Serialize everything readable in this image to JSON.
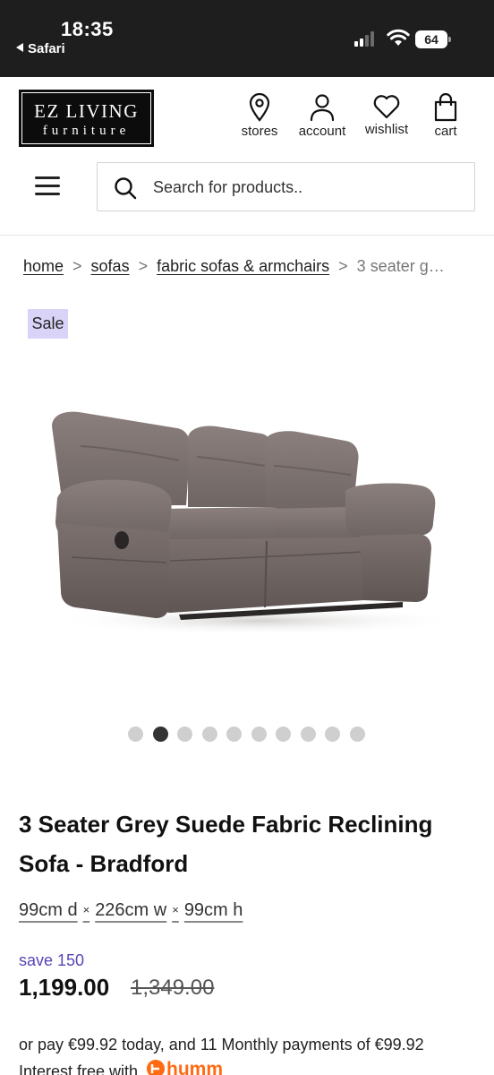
{
  "status_bar": {
    "time": "18:35",
    "back_app": "Safari",
    "battery": "64"
  },
  "header": {
    "logo_line1": "EZ LIVING",
    "logo_line2": "furniture",
    "nav": {
      "stores": "stores",
      "account": "account",
      "wishlist": "wishlist",
      "cart": "cart"
    },
    "search_placeholder": "Search for products.."
  },
  "breadcrumb": {
    "items": [
      "home",
      "sofas",
      "fabric sofas & armchairs"
    ],
    "current": "3 seater g…",
    "separator": ">"
  },
  "product": {
    "badge": "Sale",
    "image_icon": "sofa-image",
    "carousel": {
      "total": 10,
      "active_index": 1
    },
    "title": "3 Seater Grey Suede Fabric Reclining Sofa - Bradford",
    "dimensions": {
      "d": "99cm d",
      "w": "226cm w",
      "h": "99cm h",
      "sep": "×"
    },
    "save": "save 150",
    "price": "1,199.00",
    "was_price": "1,349.00",
    "finance_line1": "or pay €99.92 today, and 11 Monthly payments of €99.92",
    "finance_line2": "Interest free with",
    "finance_brand": "humm"
  },
  "colors": {
    "status_bar_bg": "#1e1e1e",
    "sale_badge_bg": "#d9d3f7",
    "save_text": "#5b45b8",
    "humm_orange": "#ff6a13"
  }
}
